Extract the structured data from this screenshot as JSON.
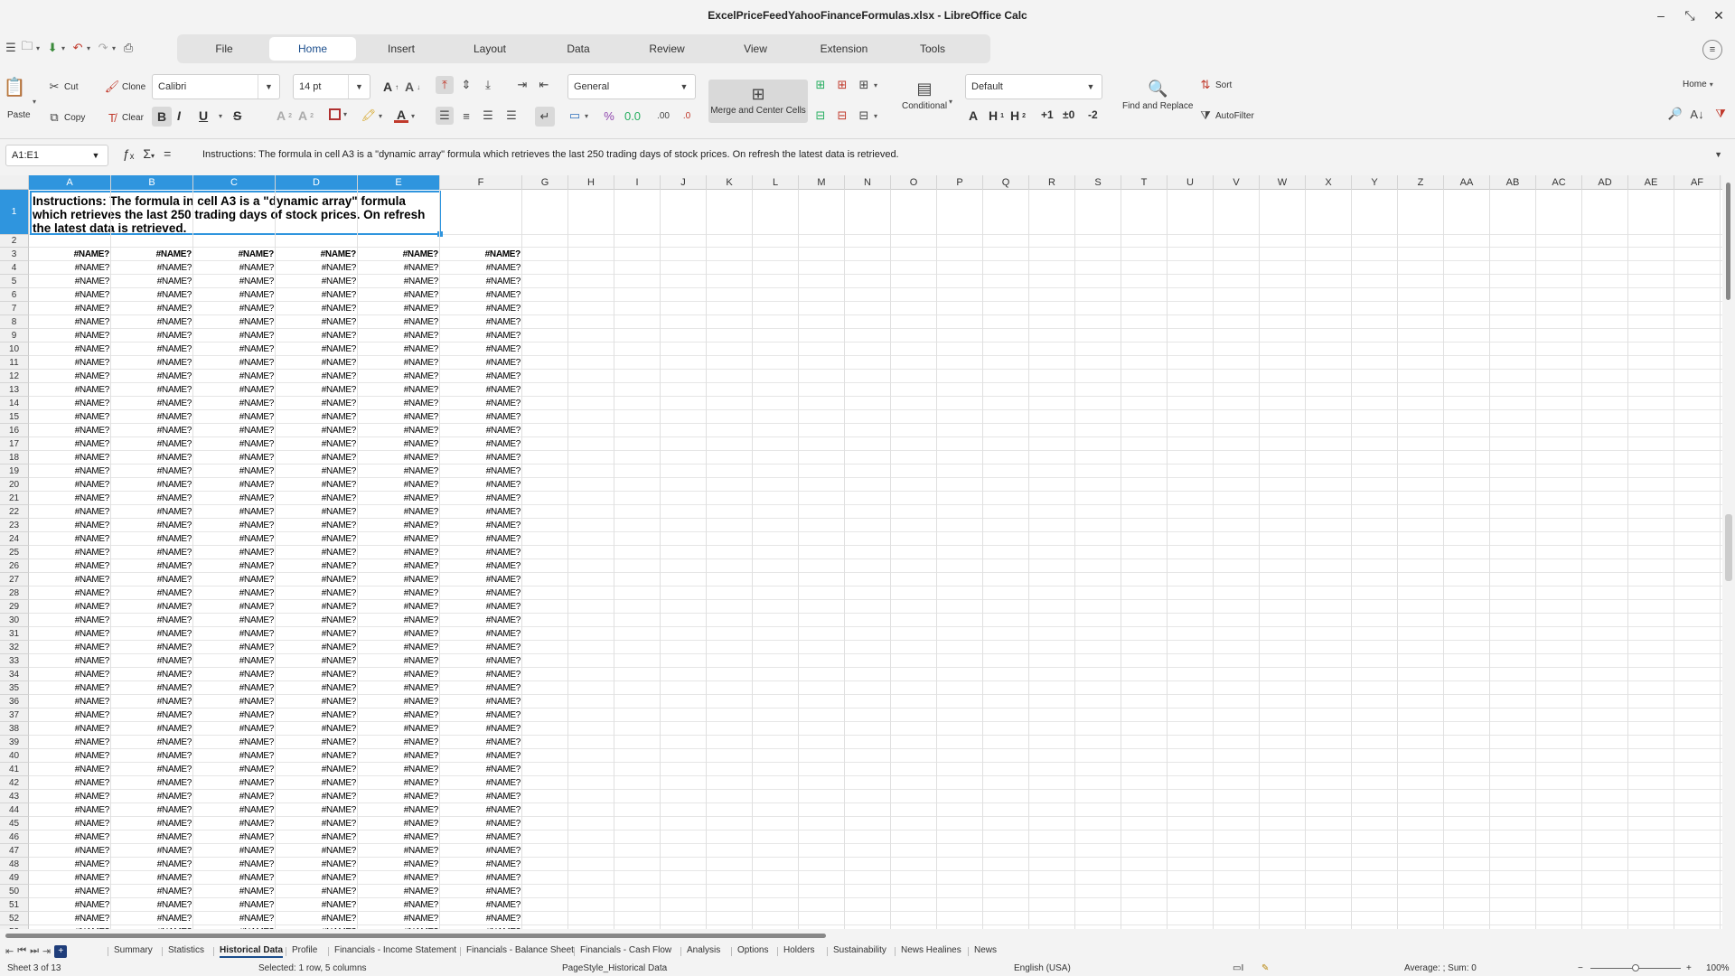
{
  "window": {
    "title": "ExcelPriceFeedYahooFinanceFormulas.xlsx - LibreOffice Calc"
  },
  "menu_tabs": [
    "File",
    "Home",
    "Insert",
    "Layout",
    "Data",
    "Review",
    "View",
    "Extension",
    "Tools"
  ],
  "active_tab": "Home",
  "ribbon": {
    "paste": "Paste",
    "cut": "Cut",
    "copy": "Copy",
    "clone": "Clone",
    "clear": "Clear",
    "font_name": "Calibri",
    "font_size": "14 pt",
    "number_format": "General",
    "merge_center": "Merge and Center Cells",
    "conditional": "Conditional",
    "cell_style": "Default",
    "find_replace": "Find and Replace",
    "sort": "Sort",
    "autofilter": "AutoFilter",
    "home_dropdown": "Home",
    "heading_h1": "H",
    "heading_h2": "H",
    "plus1": "+1",
    "pm0": "±0",
    "minus2": "-2"
  },
  "formula_bar": {
    "name_box": "A1:E1",
    "content": "Instructions: The formula in cell A3 is a \"dynamic array\" formula which retrieves the last 250 trading days of stock prices. On refresh the latest data is retrieved."
  },
  "columns": [
    "A",
    "B",
    "C",
    "D",
    "E",
    "F",
    "G",
    "H",
    "I",
    "J",
    "K",
    "L",
    "M",
    "N",
    "O",
    "P",
    "Q",
    "R",
    "S",
    "T",
    "U",
    "V",
    "W",
    "X",
    "Y",
    "Z",
    "AA",
    "AB",
    "AC",
    "AD",
    "AE",
    "AF"
  ],
  "merged_cell_text": "Instructions: The formula in cell A3 is a \"dynamic array\" formula which retrieves the last 250 trading days of stock prices. On refresh the latest data is retrieved.",
  "cell_value": "#NAME?",
  "sheets": [
    "Summary",
    "Statistics",
    "Historical Data",
    "Profile",
    "Financials - Income Statement",
    "Financials - Balance Sheet",
    "Financials - Cash Flow",
    "Analysis",
    "Options",
    "Holders",
    "Sustainability",
    "News Healines",
    "News"
  ],
  "active_sheet": "Historical Data",
  "status": {
    "sheet": "Sheet 3 of 13",
    "selection": "Selected: 1 row, 5 columns",
    "page_style": "PageStyle_Historical Data",
    "language": "English (USA)",
    "summary": "Average: ; Sum: 0",
    "zoom": "100%"
  }
}
